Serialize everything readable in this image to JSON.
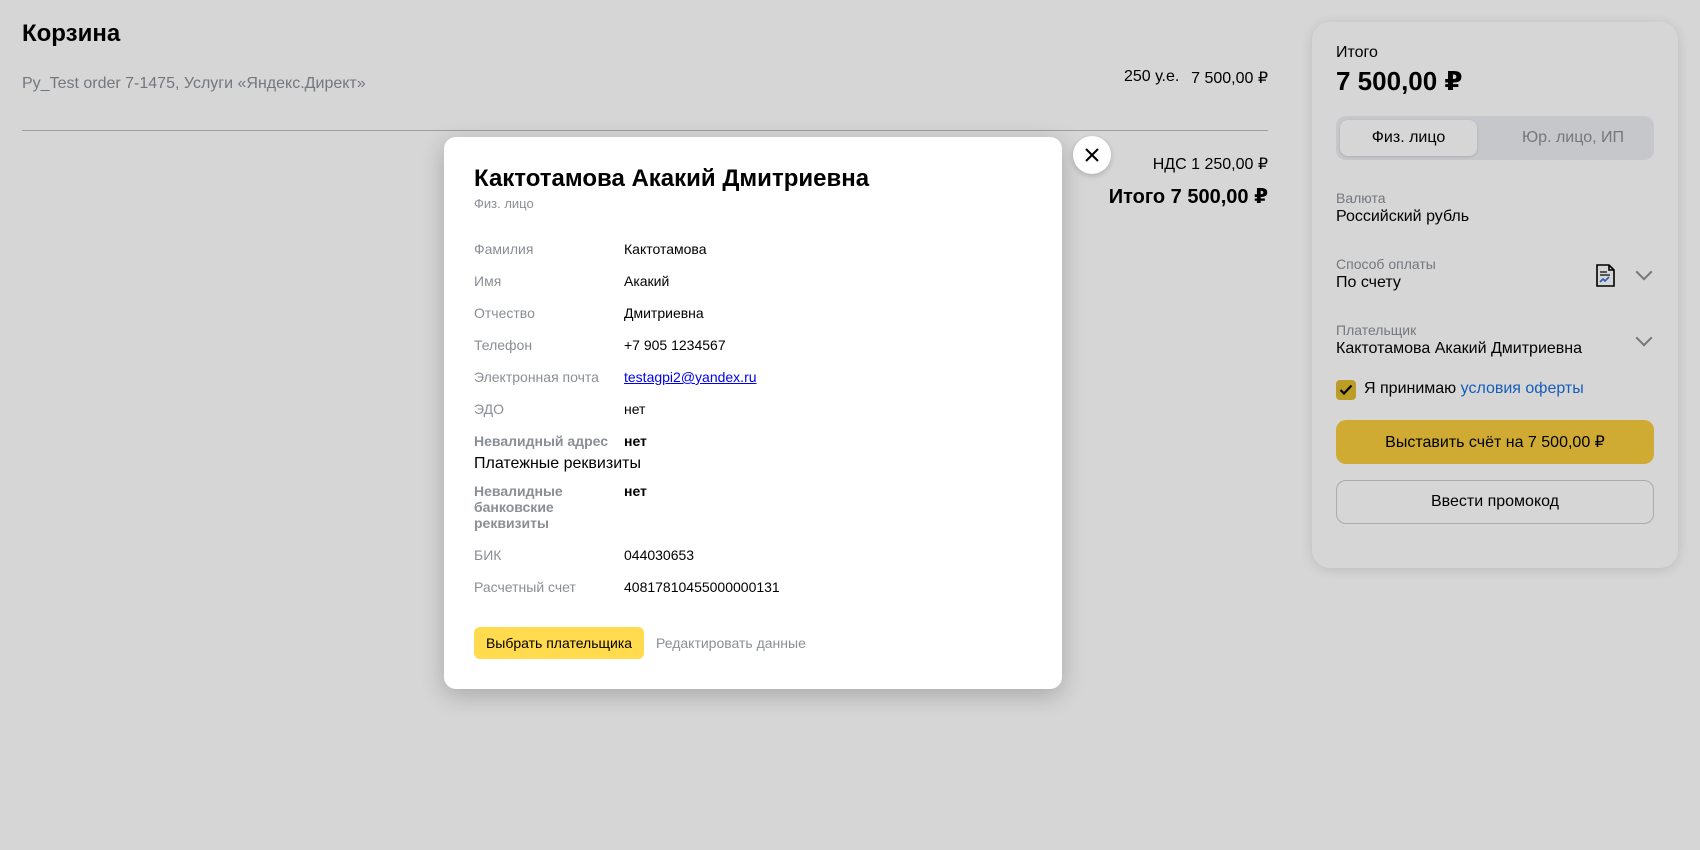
{
  "page": {
    "title": "Корзина",
    "order_name": "Py_Test order 7-1475, Услуги «Яндекс.Директ»",
    "order_qty": "250 у.е.",
    "order_price": "7 500,00 ₽",
    "vat": "НДС 1 250,00 ₽",
    "total": "Итого 7 500,00 ₽"
  },
  "side_panel": {
    "total_label": "Итого",
    "total_value": "7 500,00 ₽",
    "toggle": {
      "individual": "Физ. лицо",
      "legal": "Юр. лицо, ИП",
      "selected": "individual"
    },
    "currency_label": "Валюта",
    "currency_value": "Российский рубль",
    "payment_method_label": "Способ оплаты",
    "payment_method_value": "По счету",
    "payer_label": "Плательщик",
    "payer_value": "Кактотамова Акакий Дмитриевна",
    "accept_checked": true,
    "accept_text": "Я принимаю",
    "accept_link": "условия оферты",
    "invoice_button": "Выставить счёт на 7 500,00 ₽",
    "promo_button": "Ввести промокод"
  },
  "modal": {
    "title": "Кактотамова Акакий Дмитриевна",
    "subtitle": "Физ. лицо",
    "rows": [
      {
        "label": "Фамилия",
        "value": "Кактотамова"
      },
      {
        "label": "Имя",
        "value": "Акакий"
      },
      {
        "label": "Отчество",
        "value": "Дмитриевна"
      },
      {
        "label": "Телефон",
        "value": "+7 905 1234567"
      },
      {
        "label": "Электронная почта",
        "value": "testagpi2@yandex.ru"
      },
      {
        "label": "ЭДО",
        "value": "нет"
      },
      {
        "label": "Невалидный адрес",
        "value": "нет"
      }
    ],
    "section_title": "Платежные реквизиты",
    "bank_rows": [
      {
        "label": "Невалидные банковские реквизиты",
        "value": "нет"
      },
      {
        "label": "БИК",
        "value": "044030653"
      },
      {
        "label": "Расчетный счет",
        "value": "40817810455000000131"
      }
    ],
    "choose_button": "Выбрать плательщика",
    "edit_link": "Редактировать данные"
  },
  "colors": {
    "accent_yellow": "#ffdb4d",
    "invoice_yellow": "#f7cc3e",
    "link_blue": "#1a6fdc",
    "muted_text": "#8a8f96"
  }
}
